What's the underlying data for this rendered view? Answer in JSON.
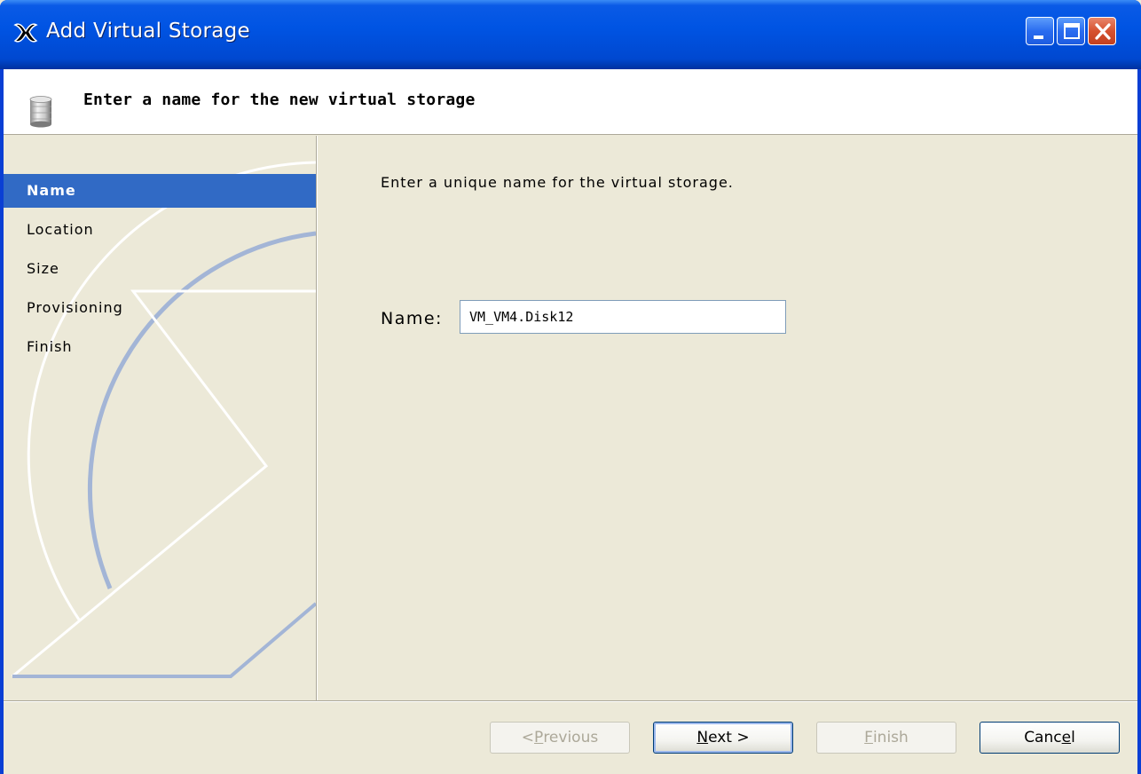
{
  "window": {
    "title": "Add Virtual Storage",
    "icon": "xen-x-icon"
  },
  "header": {
    "title": "Enter a name for the new virtual storage",
    "icon": "disk-storage-icon"
  },
  "steps": [
    {
      "label": "Name",
      "active": true
    },
    {
      "label": "Location",
      "active": false
    },
    {
      "label": "Size",
      "active": false
    },
    {
      "label": "Provisioning",
      "active": false
    },
    {
      "label": "Finish",
      "active": false
    }
  ],
  "content": {
    "instructions": "Enter a unique name for the virtual storage.",
    "name_label": "Name:",
    "name_value": "VM_VM4.Disk12"
  },
  "buttons": {
    "previous": {
      "pre": "< ",
      "mnemonic": "P",
      "post": "revious",
      "enabled": false
    },
    "next": {
      "pre": "",
      "mnemonic": "N",
      "post": "ext >",
      "enabled": true
    },
    "finish": {
      "pre": "",
      "mnemonic": "F",
      "post": "inish",
      "enabled": false
    },
    "cancel": {
      "pre": "Canc",
      "mnemonic": "e",
      "post": "l",
      "enabled": true
    }
  },
  "colors": {
    "titlebar": "#0054e3",
    "selected_step": "#316ac5",
    "dialog_bg": "#ece9d8"
  }
}
